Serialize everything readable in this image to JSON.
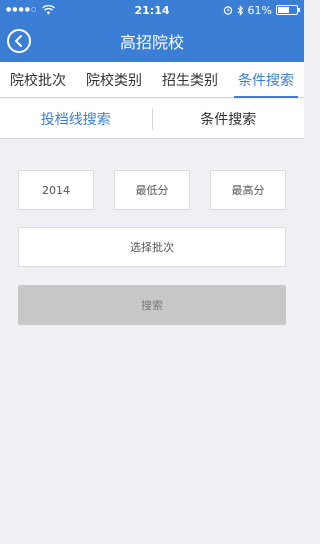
{
  "status_bar": {
    "signal": "●●●●○",
    "time": "21:14",
    "battery_text": "61%",
    "battery_level": 0.61
  },
  "nav": {
    "title": "高招院校",
    "back_icon": "chevron-left-circle-icon"
  },
  "tabs": [
    {
      "label": "院校批次",
      "active": false
    },
    {
      "label": "院校类别",
      "active": false
    },
    {
      "label": "招生类别",
      "active": false
    },
    {
      "label": "条件搜索",
      "active": true
    }
  ],
  "sub_tabs": [
    {
      "label": "投档线搜索",
      "active": true
    },
    {
      "label": "条件搜索",
      "active": false
    }
  ],
  "form": {
    "year_value": "2014",
    "min_score_placeholder": "最低分",
    "max_score_placeholder": "最高分",
    "batch_placeholder": "选择批次",
    "search_label": "搜索"
  },
  "colors": {
    "primary": "#3a7fd5",
    "background": "#efeff4",
    "button_disabled": "#c8c8c8"
  }
}
